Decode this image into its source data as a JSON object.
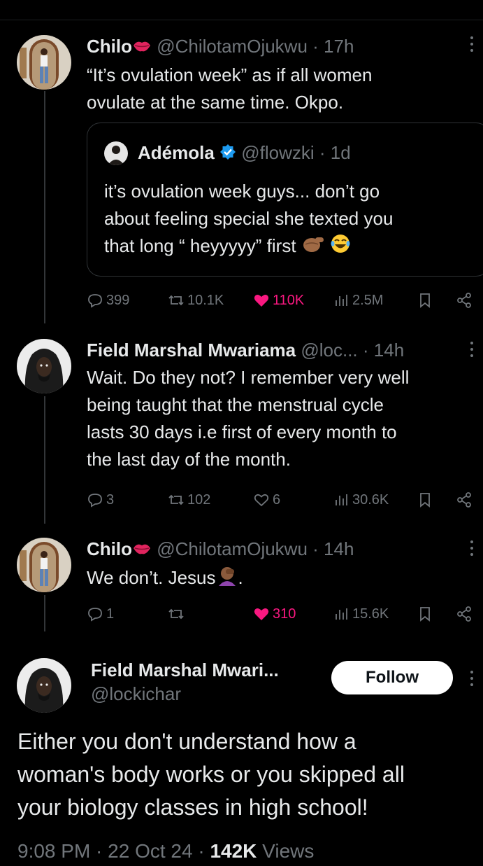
{
  "colors": {
    "background": "#000000",
    "text": "#e7e9ea",
    "muted": "#71767b",
    "like": "#f91880",
    "verified": "#1d9bf0"
  },
  "posts": [
    {
      "name": "Chilo",
      "name_emoji": "kiss-mark",
      "handle": "@ChilotamOjukwu",
      "time": "· 17h",
      "lines": [
        "“It’s ovulation week” as if all women",
        "ovulate at the same time. Okpo."
      ],
      "quote": {
        "name": "Adémola",
        "handle": "@flowzki",
        "time": "· 1d",
        "lines": [
          "it’s ovulation week guys... don’t go",
          "about feeling special she texted you",
          "that long “ heyyyyy” first"
        ]
      },
      "stats": {
        "replies": "399",
        "reposts": "10.1K",
        "likes": "110K",
        "views": "2.5M"
      }
    },
    {
      "name": "Field Marshal Mwariama",
      "handle": "@loc...",
      "time": "· 14h",
      "lines": [
        "Wait. Do they not? I remember very well",
        "being taught that the menstrual cycle",
        "lasts 30 days i.e first of every month to",
        "the last day of the month."
      ],
      "stats": {
        "replies": "3",
        "reposts": "102",
        "likes": "6",
        "views": "30.6K"
      }
    },
    {
      "name": "Chilo",
      "name_emoji": "kiss-mark",
      "handle": "@ChilotamOjukwu",
      "time": "· 14h",
      "lines": [
        "We don’t. Jesus",
        "."
      ],
      "stats": {
        "replies": "1",
        "reposts": "",
        "likes": "310",
        "views": "15.6K"
      }
    }
  ],
  "main_post": {
    "name": "Field Marshal Mwari...",
    "handle": "@lockichar",
    "follow_label": "Follow",
    "text": [
      "Either you don't understand how a",
      "woman's body works or you skipped all",
      "your biology classes in high school!"
    ],
    "time": "9:08 PM · 22 Oct 24 · ",
    "views_count": "142K",
    "views_label": "Views"
  }
}
